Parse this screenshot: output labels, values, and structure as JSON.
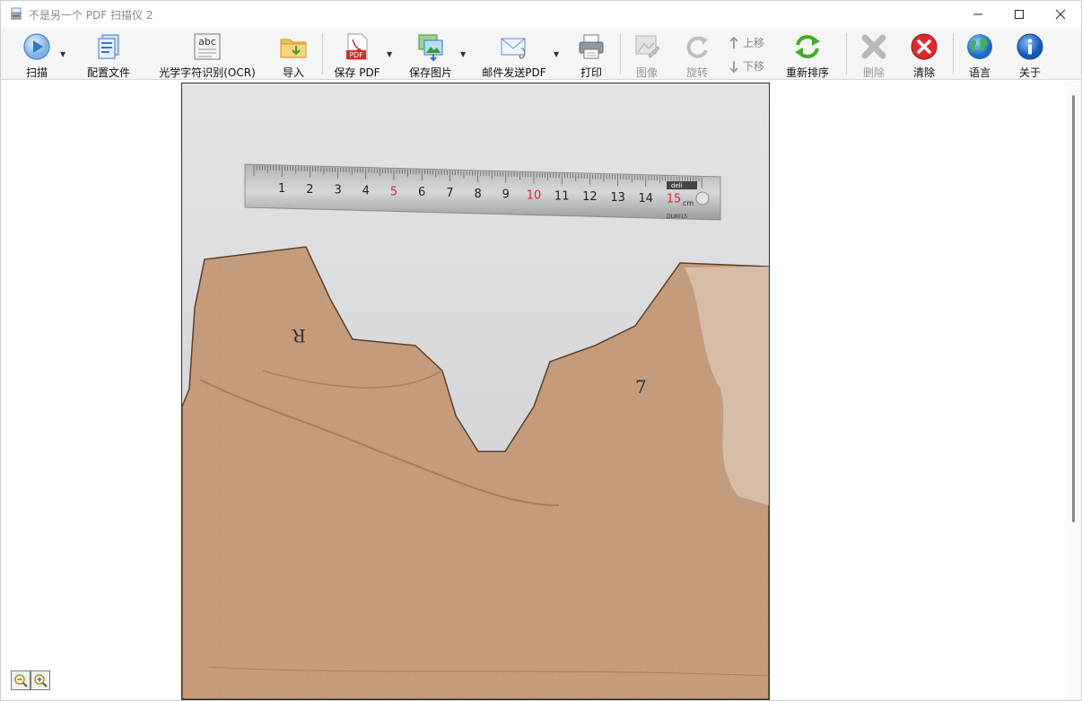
{
  "window": {
    "title": "不是另一个 PDF 扫描仪 2"
  },
  "toolbar": {
    "scan": "扫描",
    "profiles": "配置文件",
    "ocr": "光学字符识别(OCR)",
    "import": "导入",
    "save_pdf": "保存 PDF",
    "save_image": "保存图片",
    "email_pdf": "邮件发送PDF",
    "print": "打印",
    "image": "图像",
    "rotate": "旋转",
    "move_up": "上移",
    "move_down": "下移",
    "reorder": "重新排序",
    "delete": "删除",
    "clear": "清除",
    "language": "语言",
    "about": "关于",
    "ocr_icon_text": "abc",
    "pdf_icon_text": "PDF"
  },
  "scan_image": {
    "ruler_numbers": [
      "1",
      "2",
      "3",
      "4",
      "5",
      "6",
      "7",
      "8",
      "9",
      "10",
      "11",
      "12",
      "13",
      "14",
      "15"
    ],
    "ruler_unit": "cm",
    "ruler_brand": "deli",
    "ruler_model": "DL8015",
    "marks": [
      "R",
      "7"
    ]
  },
  "colors": {
    "accent": "#1e6fc8",
    "cardboard": "#c49c7c",
    "scan_bg": "#d9d9dc",
    "red": "#d42a2a"
  }
}
